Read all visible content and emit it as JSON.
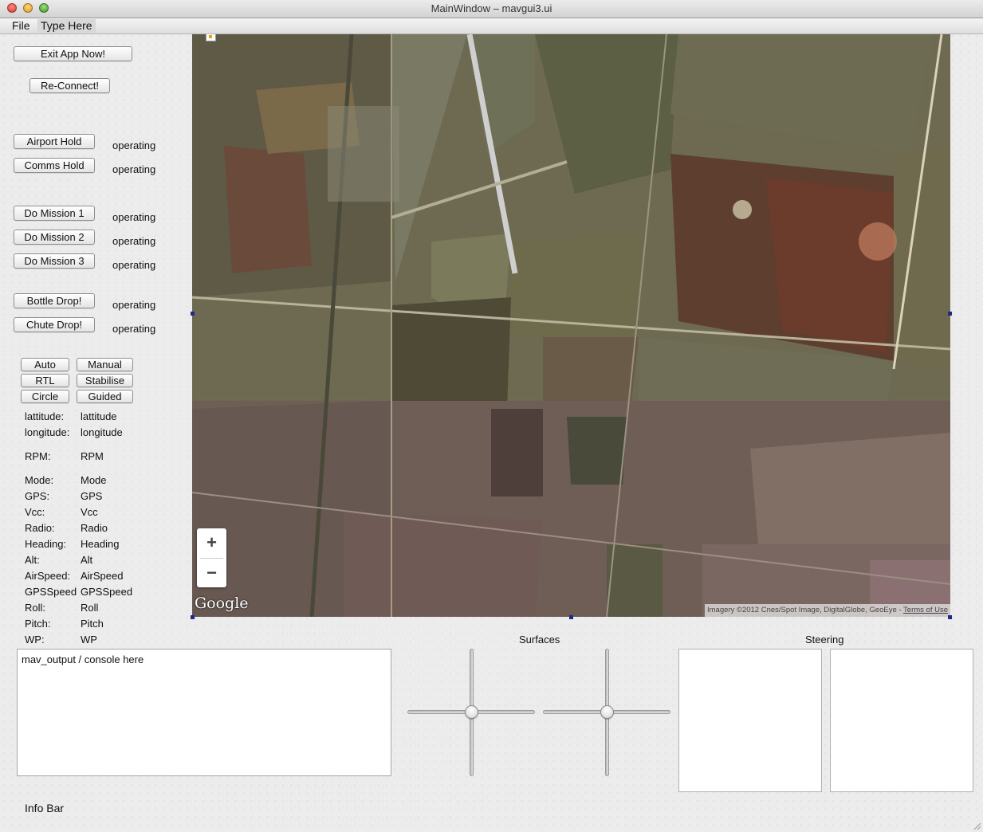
{
  "window": {
    "title": "MainWindow – mavgui3.ui"
  },
  "menu": {
    "file": "File",
    "type_here": "Type Here"
  },
  "buttons": {
    "exit": "Exit App Now!",
    "reconnect": "Re-Connect!",
    "airport_hold": "Airport Hold",
    "comms_hold": "Comms Hold",
    "mission1": "Do Mission 1",
    "mission2": "Do Mission 2",
    "mission3": "Do Mission 3",
    "bottle_drop": "Bottle Drop!",
    "chute_drop": "Chute Drop!"
  },
  "status": {
    "airport_hold": "operating",
    "comms_hold": "operating",
    "mission1": "operating",
    "mission2": "operating",
    "mission3": "operating",
    "bottle_drop": "operating",
    "chute_drop": "operating"
  },
  "modes": {
    "auto": "Auto",
    "manual": "Manual",
    "rtl": "RTL",
    "stabilise": "Stabilise",
    "circle": "Circle",
    "guided": "Guided"
  },
  "telemetry": [
    {
      "label": "lattitude:",
      "value": "lattitude"
    },
    {
      "label": "longitude:",
      "value": "longitude"
    },
    {
      "label": "RPM:",
      "value": "RPM"
    },
    {
      "label": "Mode:",
      "value": "Mode"
    },
    {
      "label": "GPS:",
      "value": "GPS"
    },
    {
      "label": "Vcc:",
      "value": "Vcc"
    },
    {
      "label": "Radio:",
      "value": "Radio"
    },
    {
      "label": "Heading:",
      "value": "Heading"
    },
    {
      "label": "Alt:",
      "value": "Alt"
    },
    {
      "label": "AirSpeed:",
      "value": "AirSpeed"
    },
    {
      "label": "GPSSpeed",
      "value": "GPSSpeed"
    },
    {
      "label": "Roll:",
      "value": "Roll"
    },
    {
      "label": "Pitch:",
      "value": "Pitch"
    },
    {
      "label": "WP:",
      "value": "WP"
    }
  ],
  "map": {
    "zoom_in": "+",
    "zoom_out": "−",
    "logo": "Google",
    "attribution": "Imagery ©2012 Cnes/Spot Image, DigitalGlobe, GeoEye - ",
    "terms": "Terms of Use"
  },
  "console": {
    "text": "mav_output / console here"
  },
  "surfaces": {
    "title": "Surfaces",
    "slider1_level": 0.5,
    "slider2_level": 0.5
  },
  "steering": {
    "title": "Steering"
  },
  "info_bar": {
    "text": "Info Bar"
  },
  "colors": {
    "selection_handle": "#1c2b8c",
    "window_bg": "#ececec"
  }
}
